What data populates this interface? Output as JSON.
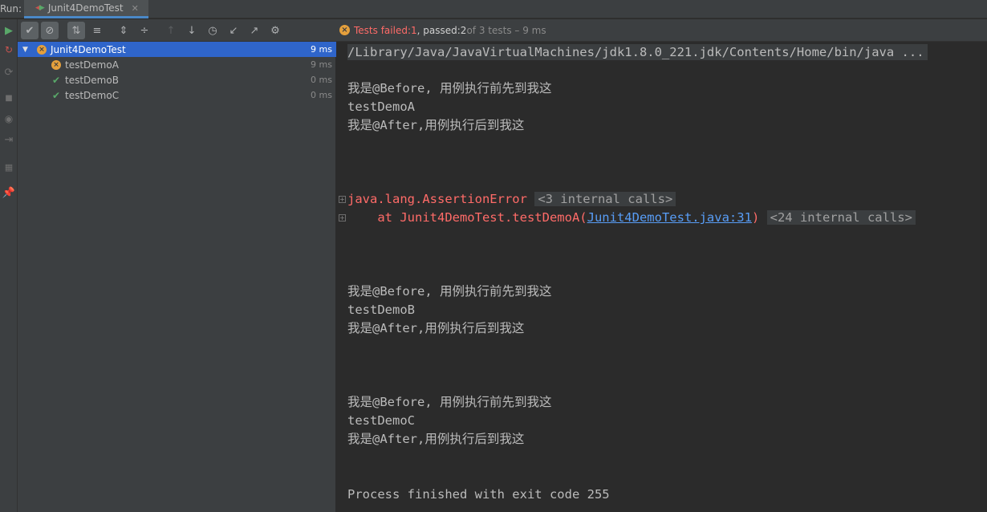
{
  "tabbar": {
    "run_label": "Run:",
    "tab_title": "Junit4DemoTest"
  },
  "status": {
    "prefix": "Tests failed: ",
    "failed": "1",
    "mid": ", passed: ",
    "passed": "2",
    "suffix": " of 3 tests – 9 ms"
  },
  "tree": {
    "root": {
      "name": "Junit4DemoTest",
      "duration": "9 ms",
      "status": "failed"
    },
    "children": [
      {
        "name": "testDemoA",
        "duration": "9 ms",
        "status": "failed"
      },
      {
        "name": "testDemoB",
        "duration": "0 ms",
        "status": "passed"
      },
      {
        "name": "testDemoC",
        "duration": "0 ms",
        "status": "passed"
      }
    ]
  },
  "console": {
    "command": "/Library/Java/JavaVirtualMachines/jdk1.8.0_221.jdk/Contents/Home/bin/java ...",
    "blockA": [
      "我是@Before, 用例执行前先到我这",
      "testDemoA",
      "我是@After,用例执行后到我这"
    ],
    "error": {
      "exception": "java.lang.AssertionError",
      "internal1": "<3 internal calls>",
      "at_prefix": "    at Junit4DemoTest.testDemoA(",
      "link": "Junit4DemoTest.java:31",
      "at_suffix": ")",
      "internal2": "<24 internal calls>"
    },
    "blockB": [
      "我是@Before, 用例执行前先到我这",
      "testDemoB",
      "我是@After,用例执行后到我这"
    ],
    "blockC": [
      "我是@Before, 用例执行前先到我这",
      "testDemoC",
      "我是@After,用例执行后到我这"
    ],
    "exit": "Process finished with exit code 255"
  },
  "colors": {
    "failed": "#ff6b68",
    "passed": "#59a869",
    "warning": "#e5a03c",
    "selection": "#2f65ca",
    "link": "#589df6"
  }
}
